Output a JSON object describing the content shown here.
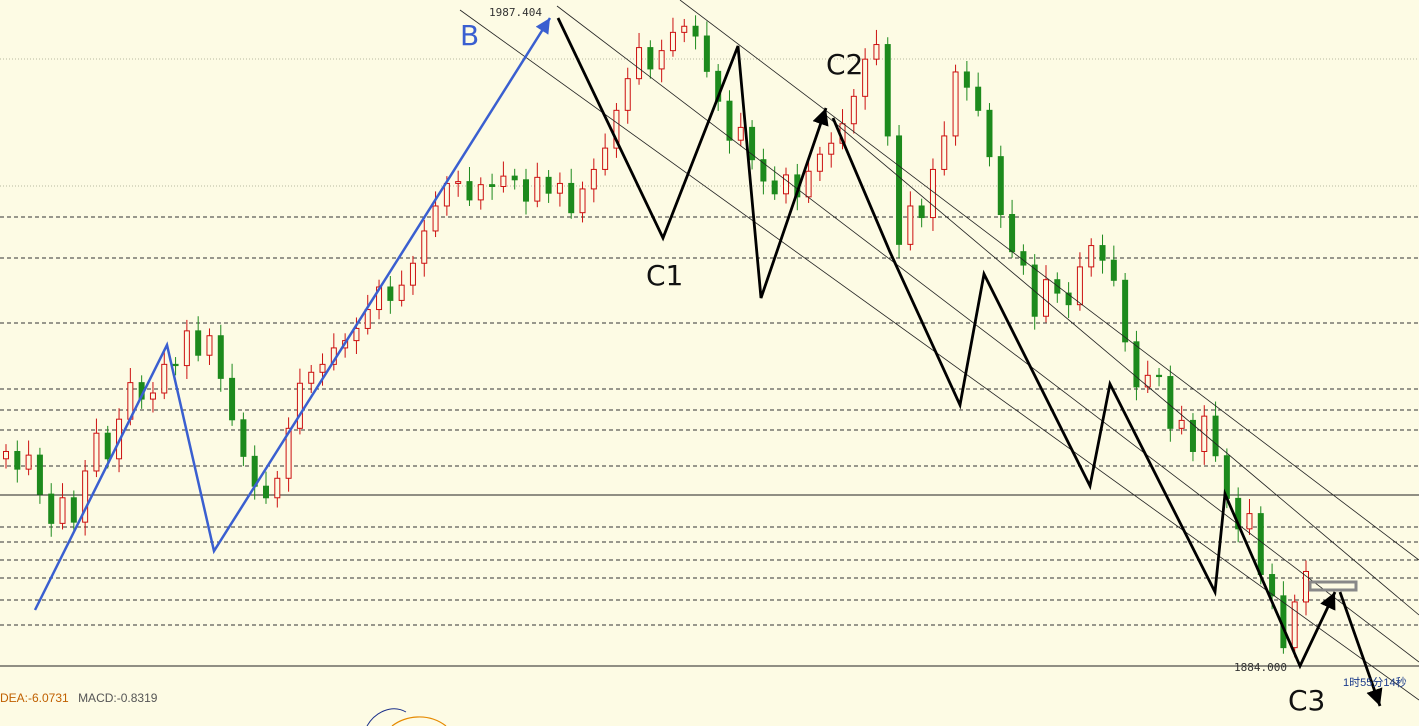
{
  "chart_data": {
    "type": "candlestick",
    "series": [
      {
        "values": [
          1916.2,
          1913.3,
          1915.6,
          1909.2,
          1904.4,
          1908.6,
          1904.6,
          1913.0,
          1919.2,
          1915.0,
          1921.5,
          1927.5,
          1924.8,
          1925.8,
          1930.5,
          1930.3,
          1936.0,
          1932.0,
          1935.2,
          1928.2,
          1921.4,
          1915.4,
          1910.5,
          1908.6,
          1911.8,
          1920.0,
          1927.4,
          1929.2,
          1930.5,
          1933.2,
          1934.4,
          1936.4,
          1939.5,
          1943.2,
          1941.0,
          1943.5,
          1947.1,
          1952.4,
          1956.5,
          1960.2,
          1960.5,
          1957.5,
          1960.0,
          1959.7,
          1961.4,
          1960.8,
          1957.3,
          1961.2,
          1958.6,
          1960.2,
          1955.4,
          1959.3,
          1962.5,
          1966.0,
          1972.2,
          1977.4,
          1982.5,
          1979.0,
          1982.0,
          1985.0,
          1986.0,
          1984.4,
          1978.6,
          1973.7,
          1967.3,
          1969.4,
          1964.1,
          1960.6,
          1958.5,
          1961.6,
          1958.0,
          1962.2,
          1965.0,
          1966.8,
          1970.0,
          1974.5,
          1980.6,
          1983.0,
          1968.0,
          1950.2,
          1956.5,
          1954.6,
          1962.5,
          1968.0,
          1978.5,
          1976.0,
          1972.2,
          1964.6,
          1955.1,
          1949.0,
          1946.8,
          1938.4,
          1944.4,
          1942.2,
          1940.3,
          1946.5,
          1950.0,
          1947.6,
          1944.3,
          1934.2,
          1926.8,
          1928.7,
          1928.5,
          1920.0,
          1921.3,
          1916.2,
          1922.0,
          1915.5,
          1908.5,
          1903.5,
          1906.0,
          1896.0,
          1892.5,
          1884.0,
          1891.5,
          1896.5
        ]
      }
    ],
    "ylim": [
      1880.0,
      1989.0
    ],
    "annotations": {
      "high_label": "1987.404",
      "low_label": "1884.000",
      "waves": [
        "B",
        "C1",
        "C2",
        "C3"
      ]
    }
  },
  "footer": {
    "dea": "DEA:-6.0731",
    "macd": "MACD:-0.8319",
    "timer": "1时55分14秒"
  },
  "colors": {
    "background": "#fdfbe4",
    "up_candle": "#cc1010",
    "down_candle": "#1d8a1d",
    "wave_B": "#3a5fd0",
    "wave_C": "#000000"
  }
}
